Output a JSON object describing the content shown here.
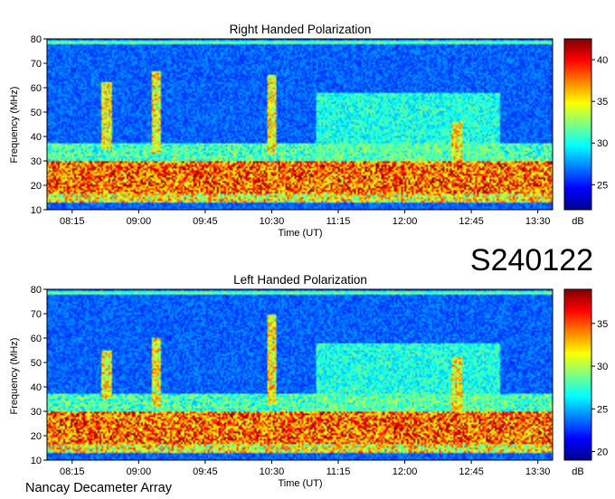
{
  "figure": {
    "code_label": "S240122",
    "footer": "Nancay Decameter Array"
  },
  "chart_data": [
    {
      "type": "heatmap",
      "title": "Right Handed Polarization",
      "xlabel": "Time (UT)",
      "ylabel": "Frequency (MHz)",
      "x_ticks": [
        "08:15",
        "09:00",
        "09:45",
        "10:30",
        "11:15",
        "12:00",
        "12:45",
        "13:30"
      ],
      "y_ticks": [
        10,
        20,
        30,
        40,
        50,
        60,
        70,
        80
      ],
      "xlim": [
        "07:58",
        "13:40"
      ],
      "ylim": [
        10,
        80
      ],
      "colorbar": {
        "label": "dB",
        "ticks": [
          25,
          30,
          35,
          40
        ],
        "range": [
          22,
          42.5
        ],
        "colormap": "jet"
      },
      "features": [
        {
          "kind": "bright band",
          "freq_MHz": [
            17,
            30
          ]
        },
        {
          "kind": "emission burst",
          "time": "08:38",
          "freq_MHz": [
            35,
            62
          ]
        },
        {
          "kind": "emission burst",
          "time": "09:12",
          "freq_MHz": [
            33,
            67
          ]
        },
        {
          "kind": "emission burst",
          "time": "10:30",
          "freq_MHz": [
            33,
            65
          ]
        },
        {
          "kind": "emission burst",
          "time": "12:35",
          "freq_MHz": [
            28,
            46
          ]
        }
      ]
    },
    {
      "type": "heatmap",
      "title": "Left Handed Polarization",
      "xlabel": "Time (UT)",
      "ylabel": "Frequency (MHz)",
      "x_ticks": [
        "08:15",
        "09:00",
        "09:45",
        "10:30",
        "11:15",
        "12:00",
        "12:45",
        "13:30"
      ],
      "y_ticks": [
        10,
        20,
        30,
        40,
        50,
        60,
        70,
        80
      ],
      "xlim": [
        "07:58",
        "13:40"
      ],
      "ylim": [
        10,
        80
      ],
      "colorbar": {
        "label": "dB",
        "ticks": [
          20,
          25,
          30,
          35
        ],
        "range": [
          19,
          39
        ],
        "colormap": "jet"
      },
      "features": [
        {
          "kind": "bright band",
          "freq_MHz": [
            17,
            30
          ]
        },
        {
          "kind": "emission burst",
          "time": "08:38",
          "freq_MHz": [
            35,
            55
          ]
        },
        {
          "kind": "emission burst",
          "time": "09:12",
          "freq_MHz": [
            32,
            60
          ]
        },
        {
          "kind": "emission burst",
          "time": "10:30",
          "freq_MHz": [
            33,
            70
          ]
        },
        {
          "kind": "emission burst",
          "time": "12:35",
          "freq_MHz": [
            27,
            52
          ]
        }
      ]
    }
  ]
}
